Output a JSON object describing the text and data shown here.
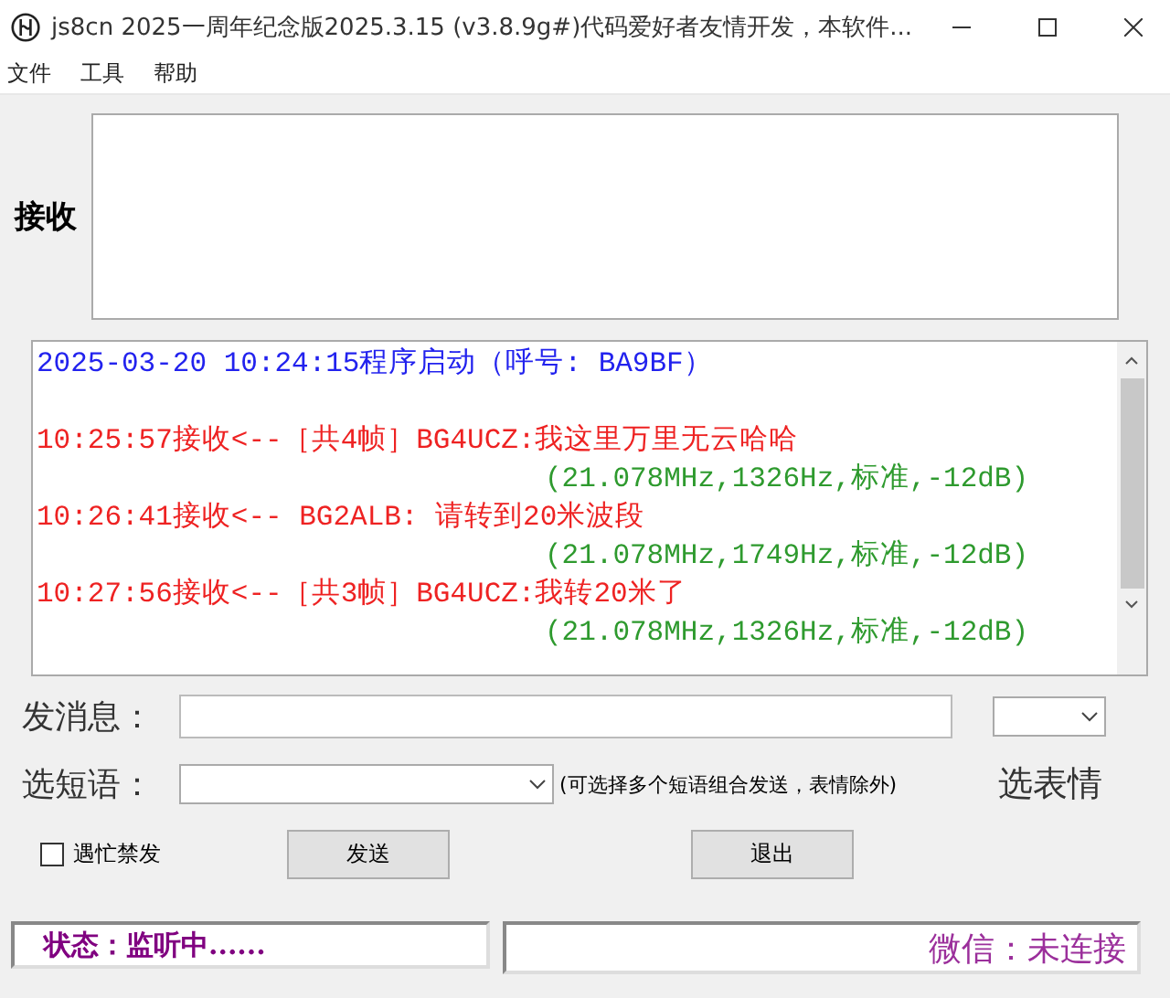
{
  "window": {
    "title": "js8cn 2025一周年纪念版2025.3.15  (v3.8.9g#)代码爱好者友情开发，本软件..."
  },
  "menu": [
    "文件",
    "工具",
    "帮助"
  ],
  "receive": {
    "label": "接收"
  },
  "log": [
    {
      "kind": "system",
      "text": "2025-03-20 10:24:15程序启动（呼号: BA9BF）"
    },
    {
      "kind": "recv",
      "text": "10:25:57接收<--［共4帧］BG4UCZ:我这里万里无云哈哈",
      "detail": "(21.078MHz,1326Hz,标准,-12dB)"
    },
    {
      "kind": "recv",
      "text": "10:26:41接收<-- BG2ALB: 请转到20米波段",
      "detail": "(21.078MHz,1749Hz,标准,-12dB)"
    },
    {
      "kind": "recv",
      "text": "10:27:56接收<--［共3帧］BG4UCZ:我转20米了",
      "detail": "(21.078MHz,1326Hz,标准,-12dB)"
    }
  ],
  "message": {
    "label": "发消息："
  },
  "phrase": {
    "label": "选短语：",
    "hint": "(可选择多个短语组合发送，表情除外)"
  },
  "emoji": {
    "label": "选表情"
  },
  "busy": {
    "label": "遇忙禁发",
    "checked": false
  },
  "buttons": [
    "发送",
    "退出"
  ],
  "status": {
    "left": "状态：监听中......",
    "right": "微信：未连接"
  }
}
